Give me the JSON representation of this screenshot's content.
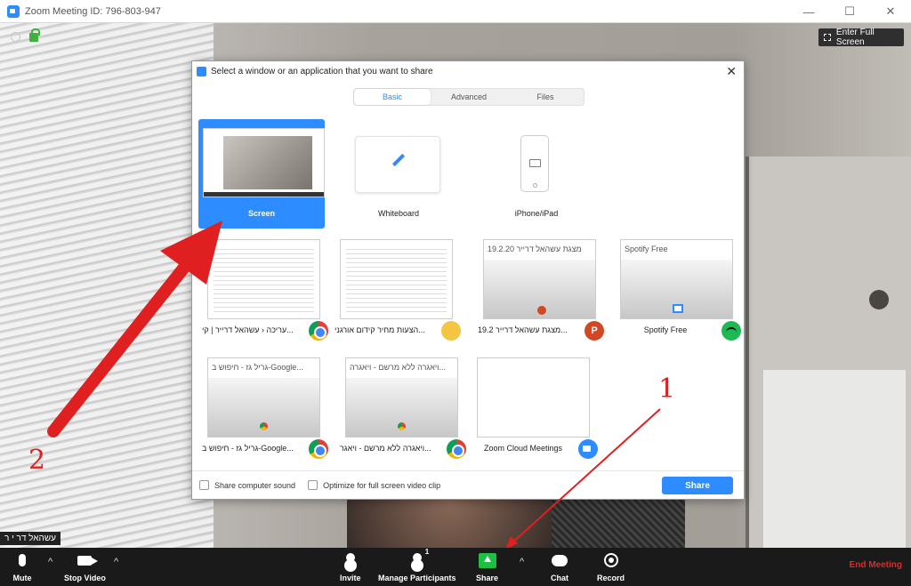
{
  "window": {
    "title": "Zoom Meeting ID: 796-803-947",
    "minimize": "—",
    "maximize": "☐",
    "close": "✕"
  },
  "video": {
    "fullscreen_label": "Enter Full Screen",
    "participant_name": "עשהאל דר י ר"
  },
  "dialog": {
    "title": "Select a window or an application that you want to share",
    "close": "✕",
    "tabs": [
      {
        "label": "Basic",
        "active": true
      },
      {
        "label": "Advanced",
        "active": false
      },
      {
        "label": "Files",
        "active": false
      }
    ],
    "tiles": [
      {
        "label": "Screen",
        "selected": true
      },
      {
        "label": "Whiteboard"
      },
      {
        "label": "iPhone/iPad"
      }
    ],
    "apps": [
      {
        "label": "עריכה ‹ עשהאל דרייר | קי...",
        "icon": "chrome-icon"
      },
      {
        "label": "הצעות מחיר קידום אורגני...",
        "icon": "folder-icon"
      },
      {
        "label": "מצגת עשהאל דרייר 19.2...",
        "thumb_title": "מצגת עשהאל דרייר 19.2.20",
        "icon": "powerpoint-icon",
        "icon_text": "P"
      },
      {
        "label": "Spotify Free",
        "thumb_title": "Spotify Free",
        "icon": "spotify-icon"
      },
      {
        "label": "גריל גז - חיפוש ב-Google...",
        "thumb_title": "גריל גז - חיפוש ב-Google...",
        "icon": "chrome-icon"
      },
      {
        "label": "ויאגרה ללא מרשם - ויאגר...",
        "thumb_title": "ויאגרה ללא מרשם - ויאגרה...",
        "icon": "chrome-icon"
      },
      {
        "label": "Zoom Cloud Meetings",
        "icon": "zoom-icon"
      }
    ],
    "footer": {
      "share_sound": "Share computer sound",
      "optimize": "Optimize for full screen video clip",
      "share_button": "Share"
    }
  },
  "annotations": {
    "one": "1",
    "two": "2",
    "color": "#e02020"
  },
  "toolbar": {
    "mute": "Mute",
    "stop_video": "Stop Video",
    "invite": "Invite",
    "manage_participants": "Manage Participants",
    "participant_count": "1",
    "share": "Share",
    "chat": "Chat",
    "record": "Record",
    "end_meeting": "End Meeting",
    "caret": "^"
  },
  "colors": {
    "accent": "#2d8cff",
    "share_green": "#1fbf44",
    "end_red": "#e02828"
  }
}
